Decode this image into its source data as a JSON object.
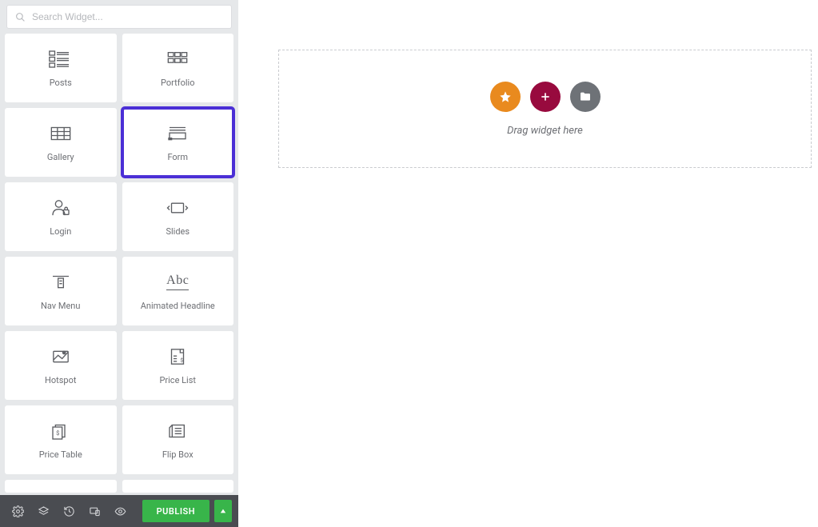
{
  "search": {
    "placeholder": "Search Widget..."
  },
  "widgets": [
    {
      "name": "Posts",
      "icon": "posts-icon",
      "selected": false
    },
    {
      "name": "Portfolio",
      "icon": "portfolio-icon",
      "selected": false
    },
    {
      "name": "Gallery",
      "icon": "gallery-icon",
      "selected": false
    },
    {
      "name": "Form",
      "icon": "form-icon",
      "selected": true
    },
    {
      "name": "Login",
      "icon": "login-icon",
      "selected": false
    },
    {
      "name": "Slides",
      "icon": "slides-icon",
      "selected": false
    },
    {
      "name": "Nav Menu",
      "icon": "navmenu-icon",
      "selected": false
    },
    {
      "name": "Animated Headline",
      "icon": "abc-icon",
      "selected": false
    },
    {
      "name": "Hotspot",
      "icon": "hotspot-icon",
      "selected": false
    },
    {
      "name": "Price List",
      "icon": "pricelist-icon",
      "selected": false
    },
    {
      "name": "Price Table",
      "icon": "pricetable-icon",
      "selected": false
    },
    {
      "name": "Flip Box",
      "icon": "flipbox-icon",
      "selected": false
    }
  ],
  "canvas": {
    "drop_hint": "Drag widget here"
  },
  "footer": {
    "publish_label": "PUBLISH"
  }
}
